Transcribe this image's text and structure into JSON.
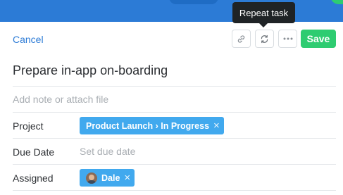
{
  "tooltip": {
    "text": "Repeat task"
  },
  "toolbar": {
    "cancel_label": "Cancel",
    "save_label": "Save",
    "icons": [
      "link-icon",
      "repeat-icon",
      "more-icon"
    ]
  },
  "task": {
    "title": "Prepare in-app on-boarding",
    "note_placeholder": "Add note or attach file"
  },
  "fields": {
    "project": {
      "label": "Project",
      "value": "Product Launch › In Progress"
    },
    "due_date": {
      "label": "Due Date",
      "placeholder": "Set due date"
    },
    "assigned": {
      "label": "Assigned",
      "value": "Dale"
    }
  },
  "colors": {
    "topbar": "#2c7bd6",
    "accent": "#2c7bd6",
    "save": "#2ecc71",
    "chip": "#41a9ee",
    "tooltip_bg": "#1f2326"
  }
}
